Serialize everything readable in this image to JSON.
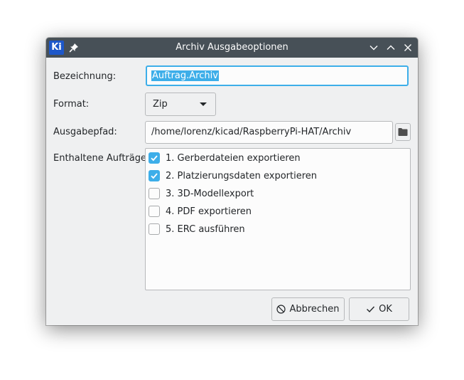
{
  "window": {
    "title": "Archiv Ausgabeoptionen",
    "app_icon_text": "Ki"
  },
  "form": {
    "name_label": "Bezeichnung:",
    "name_value": "Auftrag.Archiv",
    "format_label": "Format:",
    "format_value": "Zip",
    "path_label": "Ausgabepfad:",
    "path_value": "/home/lorenz/kicad/RaspberryPi-HAT/Archiv",
    "jobs_label": "Enthaltene Aufträge:"
  },
  "jobs": [
    {
      "text": "1.  Gerberdateien exportieren",
      "checked": true
    },
    {
      "text": "2.  Platzierungsdaten exportieren",
      "checked": true
    },
    {
      "text": "3.  3D-Modellexport",
      "checked": false
    },
    {
      "text": "4.  PDF exportieren",
      "checked": false
    },
    {
      "text": "5.  ERC ausführen",
      "checked": false
    }
  ],
  "buttons": {
    "cancel_label": "Abbrechen",
    "ok_label": "OK"
  },
  "colors": {
    "accent": "#3daee9",
    "titlebar": "#475057",
    "window_bg": "#eff0f1"
  },
  "icons": {
    "app": "kicad-icon",
    "pin": "pin-icon",
    "minimize": "chevron-down-icon",
    "maximize": "chevron-up-icon",
    "close": "close-icon",
    "browse": "folder-icon",
    "cancel": "cancel-icon",
    "ok": "checkmark-icon"
  }
}
